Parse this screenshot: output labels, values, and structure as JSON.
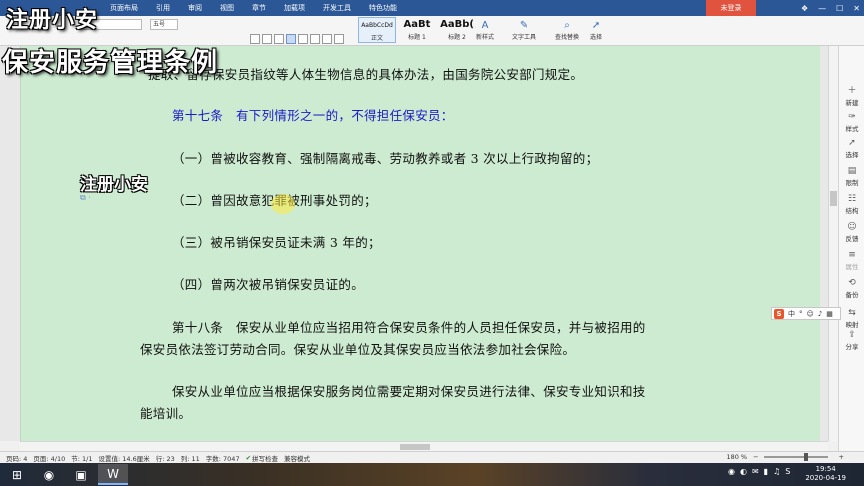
{
  "menu": [
    "页面布局",
    "引用",
    "审阅",
    "视图",
    "章节",
    "加载项",
    "开发工具",
    "特色功能"
  ],
  "login_label": "未登录",
  "ribbon": {
    "font_name": "",
    "font_size": "五号",
    "styles": [
      {
        "preview": "AaBbCcDd",
        "label": "正文"
      },
      {
        "preview": "AaBt",
        "label": "标题 1"
      },
      {
        "preview": "AaBb(",
        "label": "标题 2"
      }
    ],
    "new_style": "新样式",
    "text_tools": "文字工具",
    "find_replace": "查找替换",
    "select": "选择"
  },
  "overlay": {
    "caption1": "注册小安",
    "caption2": "保安服务管理条例",
    "caption3": "注册小安"
  },
  "document": {
    "lines": [
      {
        "text": "提取、留存保安员指纹等人体生物信息的具体办法，由国务院公安部门规定。",
        "blue": false
      },
      {
        "text": "第十七条　有下列情形之一的，不得担任保安员：",
        "blue": true
      },
      {
        "text": "（一）曾被收容教育、强制隔离戒毒、劳动教养或者 3 次以上行政拘留的；",
        "blue": false
      },
      {
        "text": "（二）曾因故意犯罪被刑事处罚的；",
        "blue": false
      },
      {
        "text": "（三）被吊销保安员证未满 3 年的；",
        "blue": false
      },
      {
        "text": "（四）曾两次被吊销保安员证的。",
        "blue": false
      },
      {
        "text": "第十八条　保安从业单位应当招用符合保安员条件的人员担任保安员，并与被招用的",
        "blue": false
      },
      {
        "text": "保安员依法签订劳动合同。保安从业单位及其保安员应当依法参加社会保险。",
        "blue": false
      },
      {
        "text": "保安从业单位应当根据保安服务岗位需要定期对保安员进行法律、保安专业知识和技",
        "blue": false
      },
      {
        "text": "能培训。",
        "blue": false
      }
    ]
  },
  "right_pane": [
    {
      "label": "新建",
      "icon": "plus-icon"
    },
    {
      "label": "样式",
      "icon": "style-icon"
    },
    {
      "label": "选择",
      "icon": "cursor-icon"
    },
    {
      "label": "限制",
      "icon": "lock-icon"
    },
    {
      "label": "结构",
      "icon": "structure-icon"
    },
    {
      "label": "反馈",
      "icon": "feedback-icon"
    },
    {
      "label": "属性",
      "icon": "property-icon"
    },
    {
      "label": "备份",
      "icon": "backup-icon"
    },
    {
      "label": "映射",
      "icon": "map-icon"
    },
    {
      "label": "分享",
      "icon": "share-icon"
    }
  ],
  "ime": {
    "lang": "中"
  },
  "status": {
    "page": "页码: 4",
    "pages": "页面: 4/10",
    "section": "节: 1/1",
    "setting": "设置值: 14.6厘米",
    "row": "行: 23",
    "col": "列: 11",
    "words": "字数: 7047",
    "spell": "拼写检查",
    "compat": "兼容模式",
    "zoom": "180 %"
  },
  "taskbar": {
    "time": "19:54",
    "date": "2020-04-19"
  }
}
